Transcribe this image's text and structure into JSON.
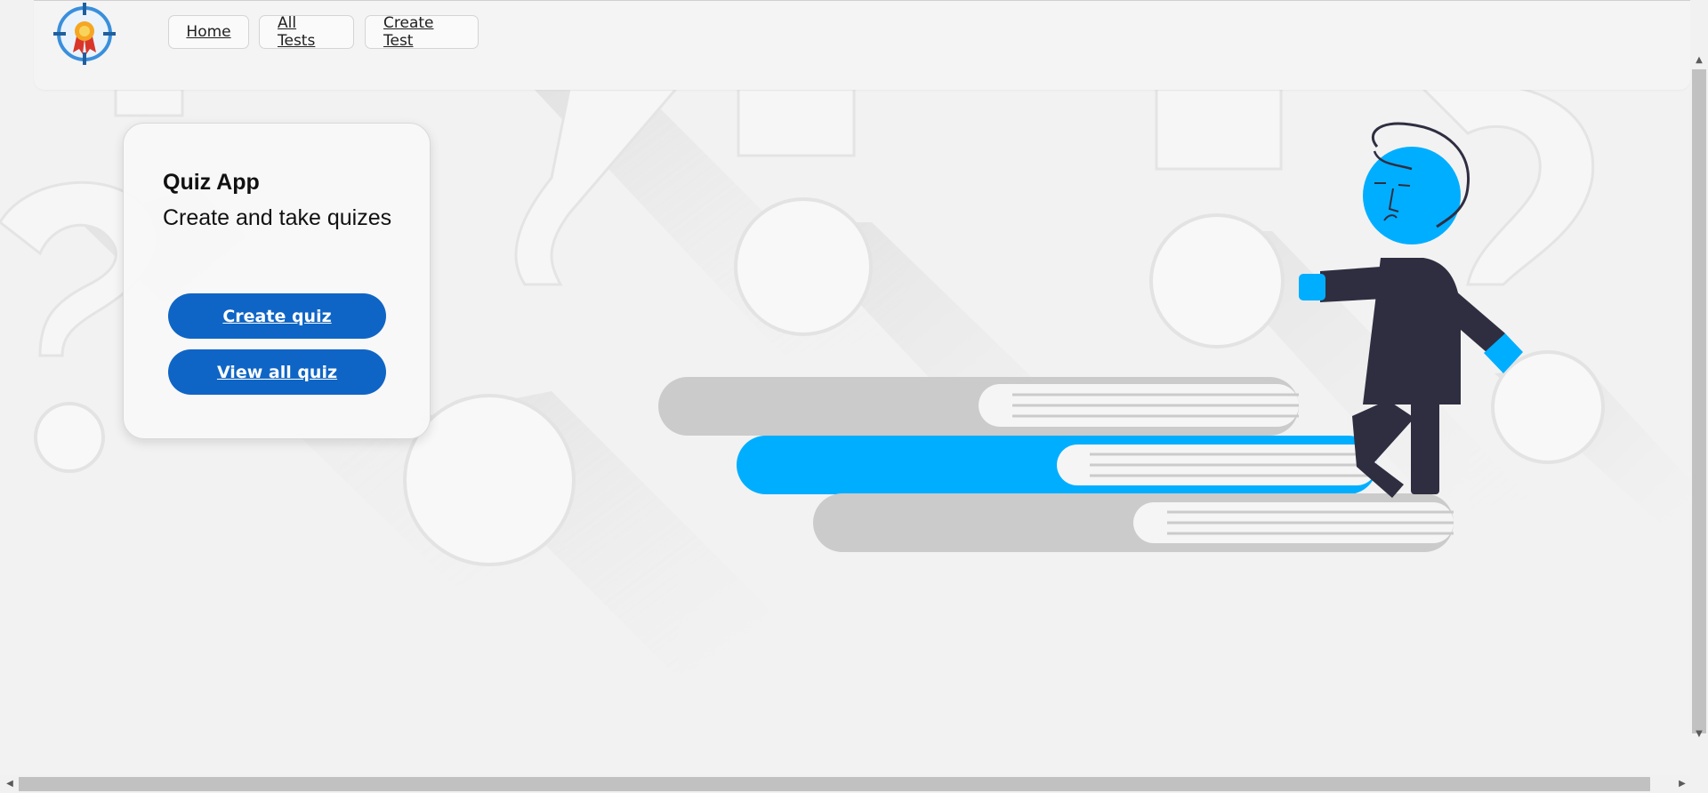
{
  "nav": {
    "home": "Home",
    "all_tests": "All Tests",
    "create_test": "Create Test"
  },
  "hero": {
    "title": "Quiz App",
    "subtitle": "Create and take quizes",
    "create_button": "Create quiz",
    "view_button": "View all quiz"
  },
  "icons": {
    "logo": "award-target-icon",
    "scroll_up": "arrow-up-icon",
    "scroll_down": "arrow-down-icon",
    "scroll_left": "arrow-left-icon",
    "scroll_right": "arrow-right-icon"
  },
  "colors": {
    "primary_button": "#0f65c5",
    "accent_blue": "#00aeff",
    "figure_dark": "#2f2e41",
    "book_gray": "#cbcbcb"
  }
}
